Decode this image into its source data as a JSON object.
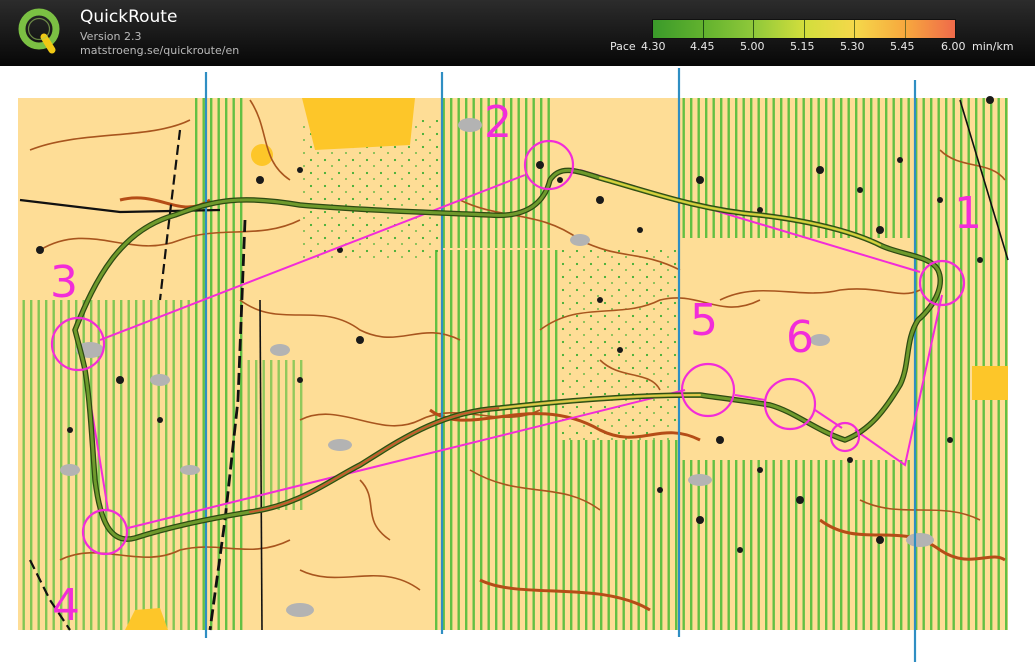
{
  "app": {
    "title": "QuickRoute",
    "version": "Version 2.3",
    "url": "matstroeng.se/quickroute/en"
  },
  "pace_legend": {
    "label": "Pace",
    "ticks": [
      "4.30",
      "4.45",
      "5.00",
      "5.15",
      "5.30",
      "5.45",
      "6.00"
    ],
    "unit": "min/km",
    "colors": [
      "#3a9a2a",
      "#62b22e",
      "#8fc83a",
      "#d2de3c",
      "#f5d84a",
      "#f7a83e",
      "#ef6a4a"
    ]
  },
  "map": {
    "land_color": "#fedd96",
    "forest_color": "#62c043",
    "contour_color": "#a8551e",
    "course_color": "#f22cd9",
    "meridian_color": "#2f8ec3",
    "route_color": "#4d7a26",
    "controls": [
      {
        "number": "1",
        "label": "1"
      },
      {
        "number": "2",
        "label": "2"
      },
      {
        "number": "3",
        "label": "3"
      },
      {
        "number": "4",
        "label": "4"
      },
      {
        "number": "5",
        "label": "5"
      },
      {
        "number": "6",
        "label": "6"
      }
    ]
  }
}
